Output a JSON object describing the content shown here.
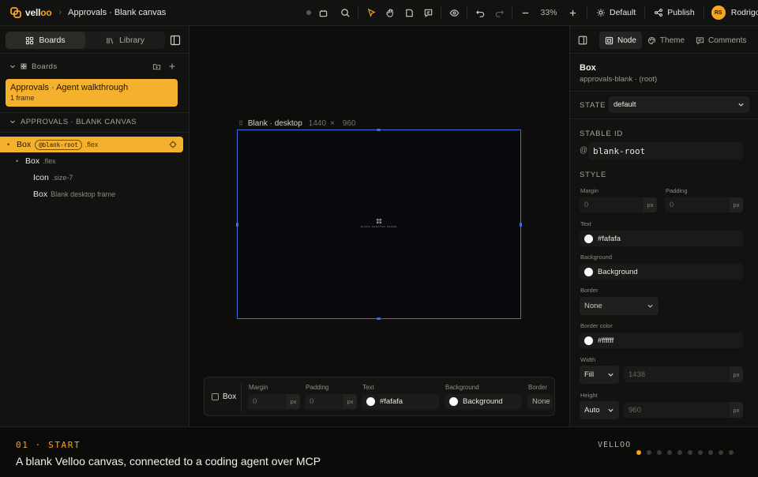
{
  "topbar": {
    "brand": "vell",
    "brand_accent": "oo",
    "breadcrumb": "Approvals · Blank canvas",
    "zoom": "33%",
    "theme_label": "Default",
    "publish_label": "Publish",
    "user_initials": "RS",
    "user_name": "Rodrigo"
  },
  "left": {
    "tabs": [
      "Boards",
      "Library"
    ],
    "boards_header": "Boards",
    "board": {
      "title": "Approvals · Agent walkthrough",
      "subtitle": "1 frame"
    },
    "canvas_header": "APPROVALS · BLANK CANVAS",
    "tree": [
      {
        "name": "Box",
        "tag": "@blank-root",
        "cls": ".flex"
      },
      {
        "name": "Box",
        "cls": ".flex"
      },
      {
        "name": "Icon",
        "cls": ".size-7"
      },
      {
        "name": "Box",
        "cls": "Blank desktop frame"
      }
    ]
  },
  "canvas": {
    "frame_name": "Blank · desktop",
    "frame_w": "1440",
    "frame_x": "×",
    "frame_h": "960",
    "frame_text": "BLANK DESKTOP FRAME"
  },
  "propbar": {
    "element": "Box",
    "margin_label": "Margin",
    "margin_placeholder": "0",
    "padding_label": "Padding",
    "padding_placeholder": "0",
    "unit": "px",
    "text_label": "Text",
    "text_value": "#fafafa",
    "background_label": "Background",
    "background_value": "Background",
    "border_label": "Border",
    "border_value": "None"
  },
  "right": {
    "tabs": [
      "Node",
      "Theme",
      "Comments"
    ],
    "title": "Box",
    "subtitle": "approvals-blank · (root)",
    "state_label": "STATE",
    "state_value": "default",
    "stable_id_label": "STABLE ID",
    "stable_id_prefix": "@",
    "stable_id": "blank-root",
    "style_label": "STYLE",
    "margin_label": "Margin",
    "padding_label": "Padding",
    "zero": "0",
    "unit": "px",
    "text_label": "Text",
    "text_value": "#fafafa",
    "background_label": "Background",
    "background_value": "Background",
    "border_label": "Border",
    "border_value": "None",
    "border_color_label": "Border color",
    "border_color_value": "#ffffff",
    "width_label": "Width",
    "width_mode": "Fill",
    "width_value": "1438",
    "height_label": "Height",
    "height_mode": "Auto",
    "height_value": "960"
  },
  "footer": {
    "step": "01 · START",
    "caption": "A blank Velloo canvas, connected to a coding agent over MCP",
    "brand": "VELLOO",
    "total_steps": 10,
    "current_step": 1
  },
  "colors": {
    "accent": "#f5a623",
    "selection": "#3a6fe0",
    "panel": "#121211"
  }
}
